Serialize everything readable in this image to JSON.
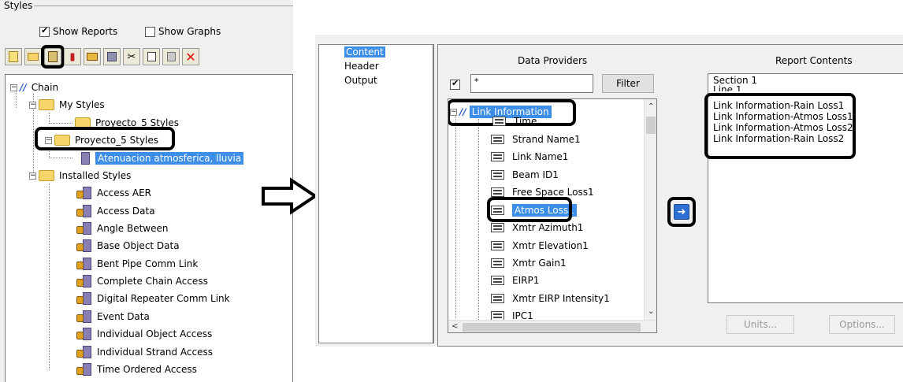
{
  "left": {
    "group_label": "Styles",
    "show_reports": {
      "label": "Show Reports",
      "checked": true
    },
    "show_graphs": {
      "label": "Show Graphs",
      "checked": false
    },
    "toolbar_icons": [
      "new-report-icon",
      "new-style-icon",
      "properties-icon",
      "graph-icon",
      "open-icon",
      "copy-style-icon",
      "cut-icon",
      "copy-icon",
      "paste-icon",
      "delete-icon"
    ],
    "tree": {
      "root": "Chain",
      "my_styles": "My Styles",
      "proyecto_a": "Proyecto_5 Styles",
      "proyecto_b": "Proyecto_5 Styles",
      "selected_report": "Atenuacion atmosferica, lluvia",
      "installed": "Installed Styles",
      "installed_items": [
        "Access AER",
        "Access Data",
        "Angle Between",
        "Base Object Data",
        "Bent Pipe Comm Link",
        "Complete Chain Access",
        "Digital Repeater Comm Link",
        "Event Data",
        "Individual Object Access",
        "Individual Strand Access",
        "Time Ordered Access"
      ]
    }
  },
  "right": {
    "nav": [
      "Content",
      "Header",
      "Output"
    ],
    "data_providers_title": "Data Providers",
    "report_contents_title": "Report Contents",
    "filter_value": "*",
    "filter_checked": true,
    "filter_button": "Filter",
    "dp_root": "Link Information",
    "dp_items": [
      "Time",
      "Strand Name1",
      "Link Name1",
      "Beam ID1",
      "Free Space Loss1",
      "Atmos Loss1",
      "Xmtr Azimuth1",
      "Xmtr Elevation1",
      "Xmtr Gain1",
      "EIRP1",
      "Xmtr EIRP Intensity1",
      "IPC1"
    ],
    "report_items": [
      "Section 1",
      "Line 1",
      "Link Information-Rain Loss1",
      "Link Information-Atmos Loss1",
      "Link Information-Atmos Loss2",
      "Link Information-Rain Loss2"
    ],
    "units_button": "Units...",
    "options_button": "Options..."
  }
}
